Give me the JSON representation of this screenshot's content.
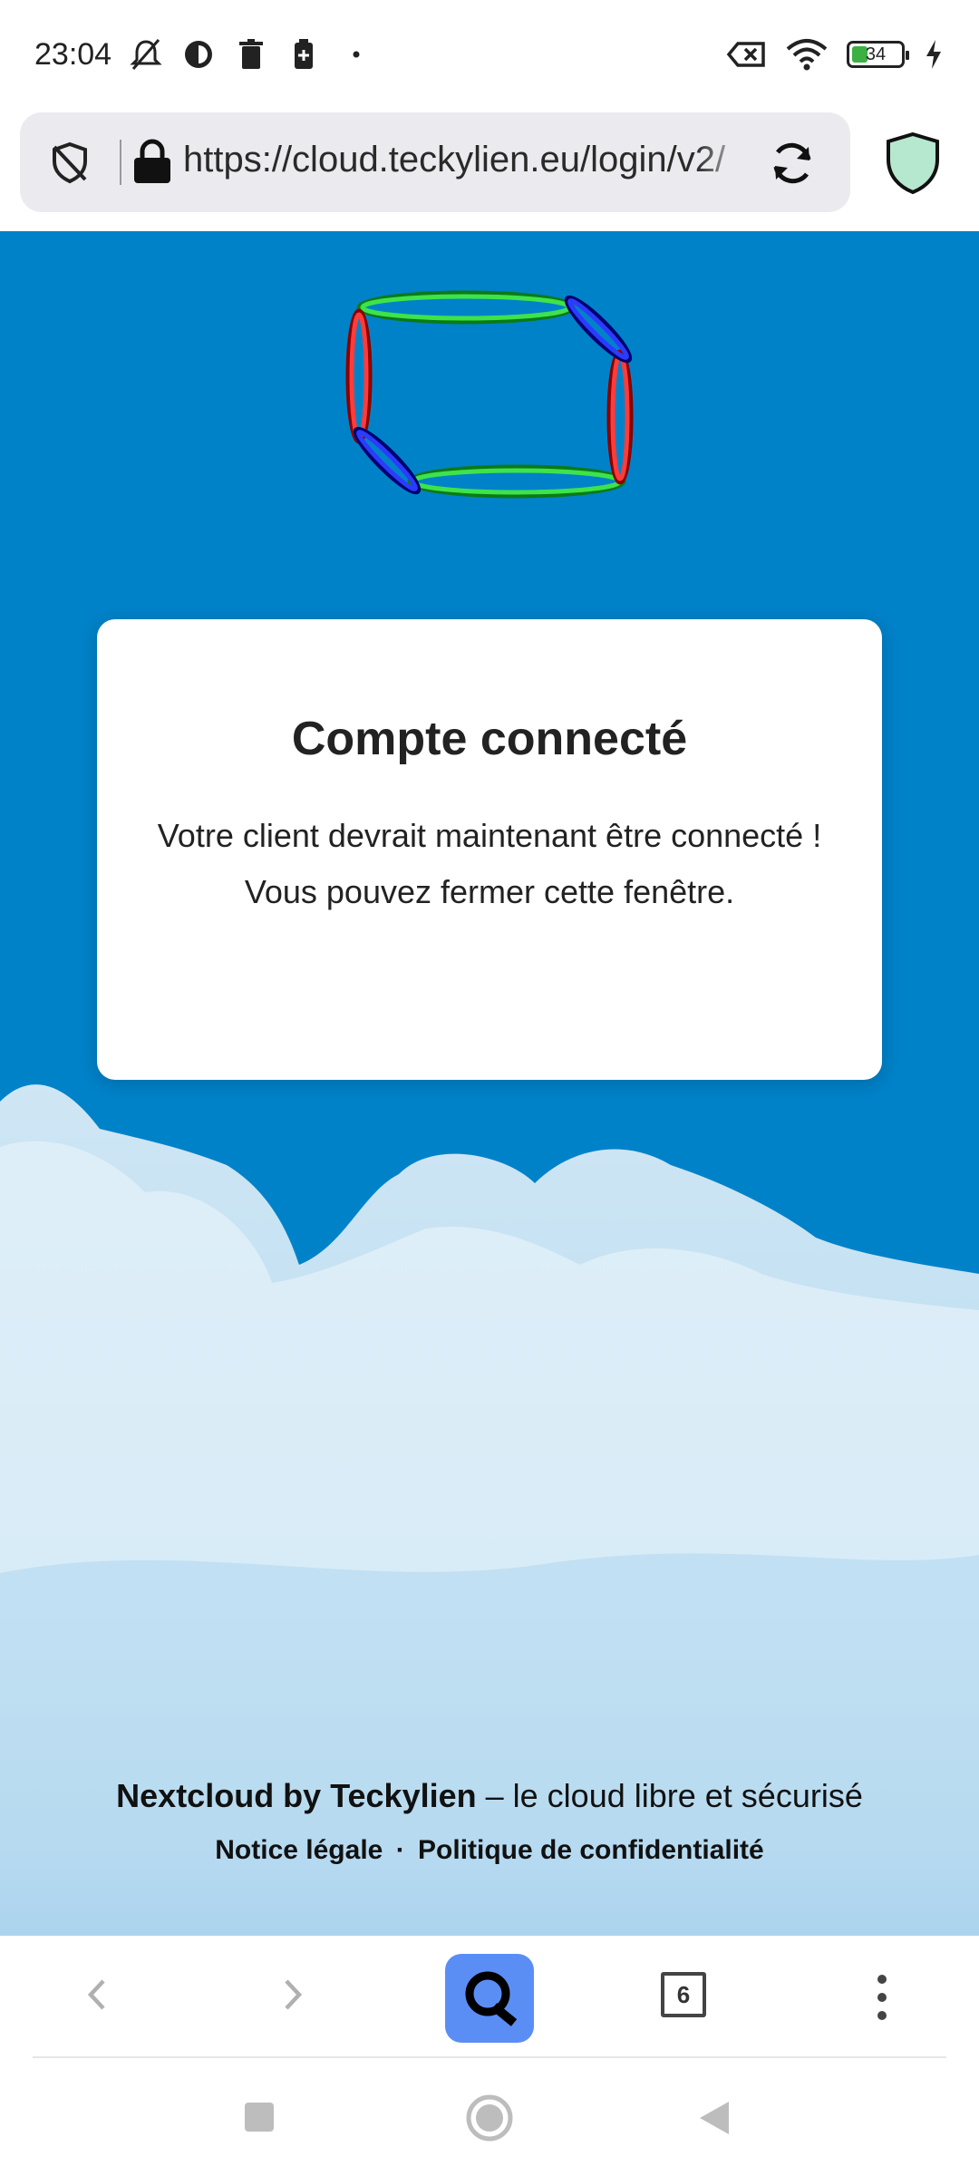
{
  "status_bar": {
    "time": "23:04",
    "battery_level": "34",
    "icons": [
      "mute-icon",
      "app-icon",
      "trash-icon",
      "battery-saver-icon",
      "dot-icon",
      "no-sim-icon",
      "wifi-icon",
      "battery-icon",
      "charging-icon"
    ]
  },
  "browser": {
    "url": "https://cloud.teckylien.eu/login/v2/",
    "tabs_count": "6",
    "icons": [
      "tracking-shield-icon",
      "lock-icon",
      "reload-icon",
      "privacy-shield-icon",
      "back-icon",
      "forward-icon",
      "search-engine-icon",
      "tabs-icon",
      "menu-icon"
    ]
  },
  "card": {
    "title": "Compte connecté",
    "line1": "Votre client devrait maintenant être connecté !",
    "line2": "Vous pouvez fermer cette fenêtre."
  },
  "footer": {
    "brand": "Nextcloud by Teckylien",
    "tagline": " – le cloud libre et sécurisé",
    "legal_link": "Notice légale",
    "separator": "·",
    "privacy_link": "Politique de confidentialité"
  },
  "colors": {
    "background_blue": "#0082c9",
    "search_button": "#5b8ef5"
  }
}
